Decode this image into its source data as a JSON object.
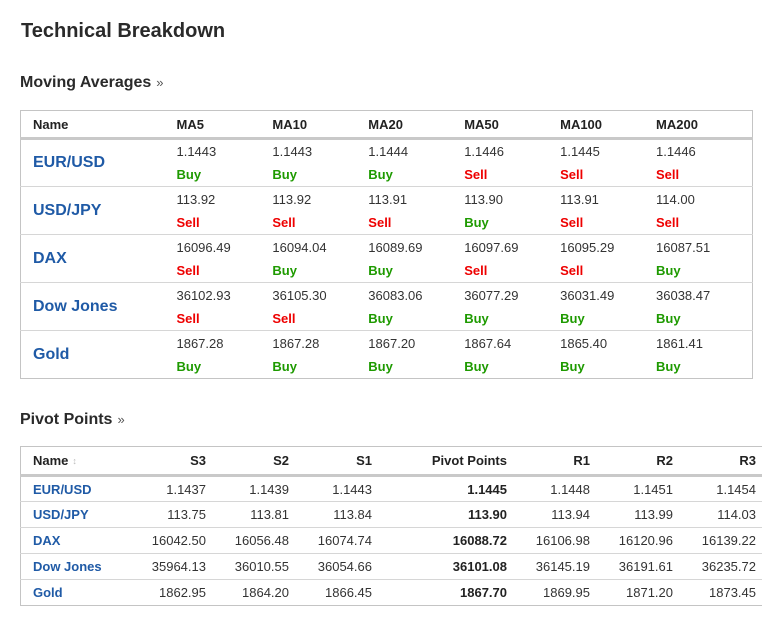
{
  "page_title": "Technical Breakdown",
  "more_glyph": "»",
  "moving_averages": {
    "title": "Moving Averages",
    "headers": [
      "Name",
      "MA5",
      "MA10",
      "MA20",
      "MA50",
      "MA100",
      "MA200"
    ],
    "rows": [
      {
        "name": "EUR/USD",
        "cells": [
          {
            "value": "1.1443",
            "signal": "Buy"
          },
          {
            "value": "1.1443",
            "signal": "Buy"
          },
          {
            "value": "1.1444",
            "signal": "Buy"
          },
          {
            "value": "1.1446",
            "signal": "Sell"
          },
          {
            "value": "1.1445",
            "signal": "Sell"
          },
          {
            "value": "1.1446",
            "signal": "Sell"
          }
        ]
      },
      {
        "name": "USD/JPY",
        "cells": [
          {
            "value": "113.92",
            "signal": "Sell"
          },
          {
            "value": "113.92",
            "signal": "Sell"
          },
          {
            "value": "113.91",
            "signal": "Sell"
          },
          {
            "value": "113.90",
            "signal": "Buy"
          },
          {
            "value": "113.91",
            "signal": "Sell"
          },
          {
            "value": "114.00",
            "signal": "Sell"
          }
        ]
      },
      {
        "name": "DAX",
        "cells": [
          {
            "value": "16096.49",
            "signal": "Sell"
          },
          {
            "value": "16094.04",
            "signal": "Buy"
          },
          {
            "value": "16089.69",
            "signal": "Buy"
          },
          {
            "value": "16097.69",
            "signal": "Sell"
          },
          {
            "value": "16095.29",
            "signal": "Sell"
          },
          {
            "value": "16087.51",
            "signal": "Buy"
          }
        ]
      },
      {
        "name": "Dow Jones",
        "cells": [
          {
            "value": "36102.93",
            "signal": "Sell"
          },
          {
            "value": "36105.30",
            "signal": "Sell"
          },
          {
            "value": "36083.06",
            "signal": "Buy"
          },
          {
            "value": "36077.29",
            "signal": "Buy"
          },
          {
            "value": "36031.49",
            "signal": "Buy"
          },
          {
            "value": "36038.47",
            "signal": "Buy"
          }
        ]
      },
      {
        "name": "Gold",
        "cells": [
          {
            "value": "1867.28",
            "signal": "Buy"
          },
          {
            "value": "1867.28",
            "signal": "Buy"
          },
          {
            "value": "1867.20",
            "signal": "Buy"
          },
          {
            "value": "1867.64",
            "signal": "Buy"
          },
          {
            "value": "1865.40",
            "signal": "Buy"
          },
          {
            "value": "1861.41",
            "signal": "Buy"
          }
        ]
      }
    ]
  },
  "pivot_points": {
    "title": "Pivot Points",
    "sort_icon": "sort-icon",
    "headers": [
      "Name",
      "S3",
      "S2",
      "S1",
      "Pivot Points",
      "R1",
      "R2",
      "R3"
    ],
    "rows": [
      {
        "name": "EUR/USD",
        "values": [
          "1.1437",
          "1.1439",
          "1.1443",
          "1.1445",
          "1.1448",
          "1.1451",
          "1.1454"
        ]
      },
      {
        "name": "USD/JPY",
        "values": [
          "113.75",
          "113.81",
          "113.84",
          "113.90",
          "113.94",
          "113.99",
          "114.03"
        ]
      },
      {
        "name": "DAX",
        "values": [
          "16042.50",
          "16056.48",
          "16074.74",
          "16088.72",
          "16106.98",
          "16120.96",
          "16139.22"
        ]
      },
      {
        "name": "Dow Jones",
        "values": [
          "35964.13",
          "36010.55",
          "36054.66",
          "36101.08",
          "36145.19",
          "36191.61",
          "36235.72"
        ]
      },
      {
        "name": "Gold",
        "values": [
          "1862.95",
          "1864.20",
          "1866.45",
          "1867.70",
          "1869.95",
          "1871.20",
          "1873.45"
        ]
      }
    ]
  },
  "colors": {
    "buy": "#1e9a00",
    "sell": "#ee0000",
    "link": "#1f5aa6"
  }
}
